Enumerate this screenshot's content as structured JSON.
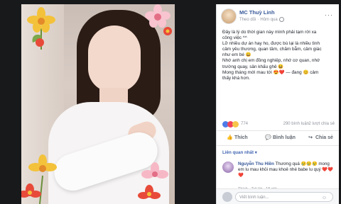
{
  "post": {
    "author": "MC Thuỳ Linh",
    "follow": "Theo dõi",
    "time": "Hôm qua",
    "text_lines": [
      "Đây là lý do thời gian này mình phải tạm rời xa",
      "công việc ^^",
      "Lỡ nhiều dự án hay ho, được bù lại là nhiều tình",
      "cảm yêu thương, quan tâm, chăm bẵm, cảm giác",
      "như em bé 😀",
      "Nhớ anh chị em đồng nghiệp, nhớ cơ quan, nhớ",
      "trường quay, sân khấu ghê 😆",
      "Mong tháng mới mau tới 😍❤️ — đang 😊 cảm",
      "thấy khá hơn."
    ]
  },
  "stats": {
    "likes": "774",
    "comments": "290 bình luận",
    "shares": "2 lượt chia sẻ"
  },
  "actions": {
    "like": "Thích",
    "comment": "Bình luận",
    "share": "Chia sẻ"
  },
  "relevant": "Liên quan nhất ▾",
  "comment": {
    "name": "Nguyễn Thu Hiền",
    "text": "Thương quá 😢😢😢 mong em lu mau khỏi mau khoẻ nhé babe lu quý ❤️❤️❤️",
    "meta": "Thích · Trả lời · 18 giờ"
  },
  "reply": {
    "placeholder": "Viết bình luận..."
  },
  "icons": {
    "like": "thumbs-up-icon",
    "comment": "comment-bubble-icon",
    "share": "share-arrow-icon"
  }
}
